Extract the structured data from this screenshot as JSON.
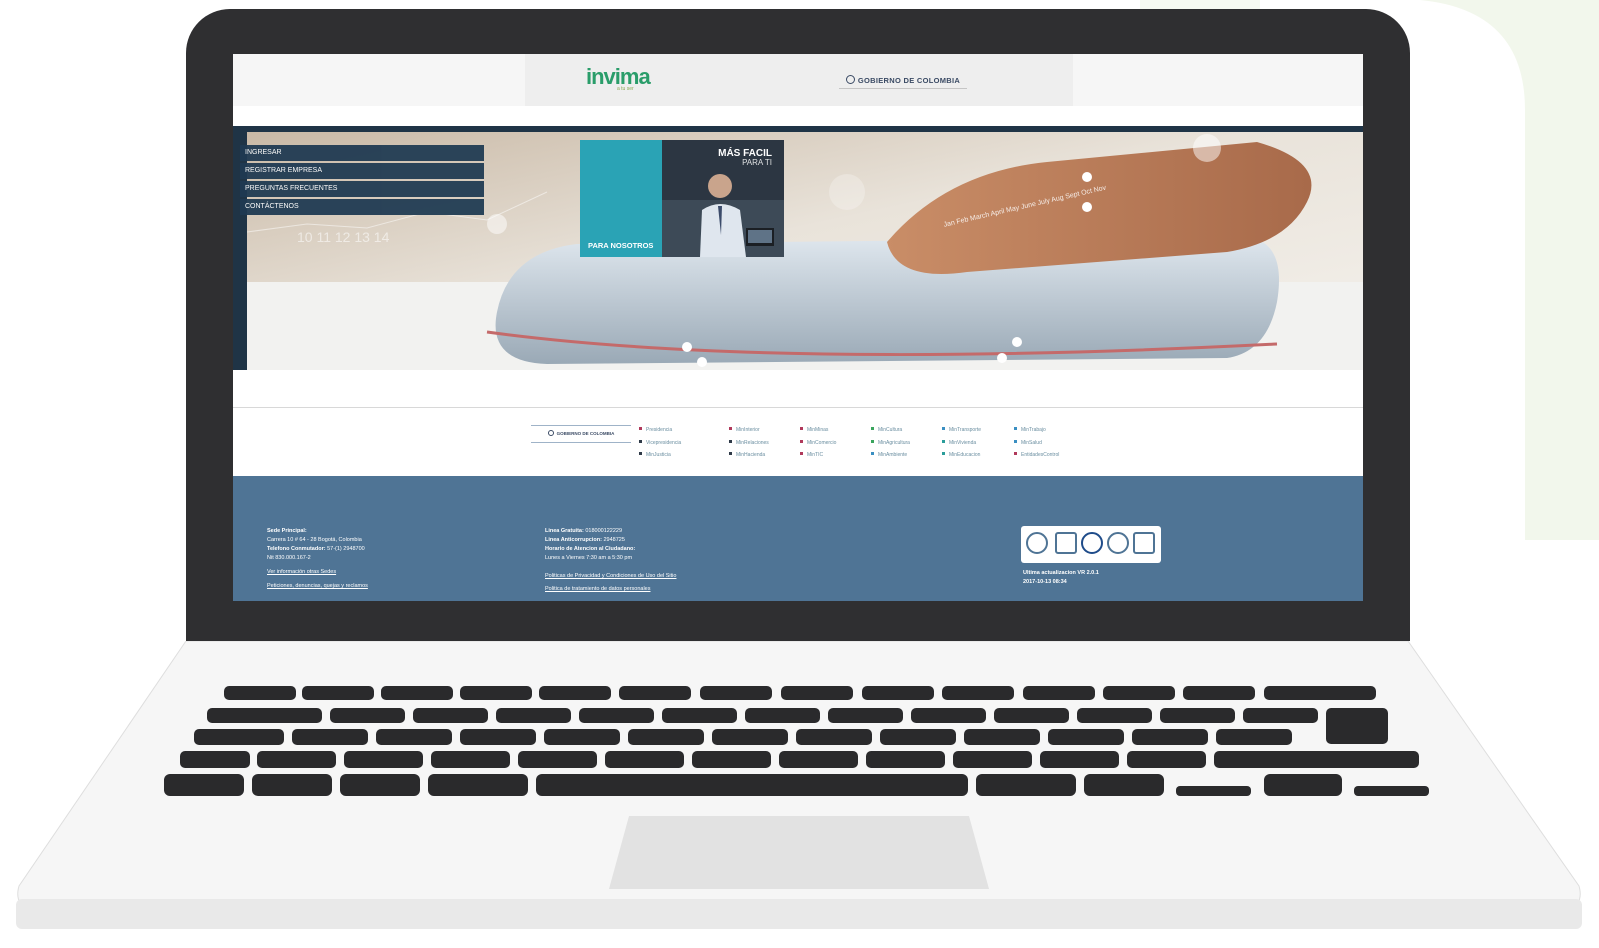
{
  "site": {
    "logo_text": "invima",
    "logo_subtext": "a tu ser",
    "gov_label": "GOBIERNO DE COLOMBIA"
  },
  "menu": {
    "items": [
      {
        "label": "INGRESAR"
      },
      {
        "label": "REGISTRAR EMPRESA"
      },
      {
        "label": "PREGUNTAS FRECUENTES"
      },
      {
        "label": "CONTÁCTENOS"
      }
    ]
  },
  "promo": {
    "title": "MÁS FACIL",
    "subtitle": "PARA TI",
    "caption": "PARA NOSOTROS"
  },
  "hero": {
    "months": "Jan  Feb  March  April  May  June  July  Aug  Sept  Oct  Nov"
  },
  "gov_links": {
    "badge": "GOBIERNO DE COLOMBIA",
    "columns": [
      [
        {
          "label": "Presidencia",
          "color": "#b0395b"
        },
        {
          "label": "Vicepresidencia",
          "color": "#2f3a48"
        },
        {
          "label": "MinJusticia",
          "color": "#2f3a48"
        }
      ],
      [
        {
          "label": "MinInterior",
          "color": "#b0395b"
        },
        {
          "label": "MinRelaciones",
          "color": "#2f3a48"
        },
        {
          "label": "MinHacienda",
          "color": "#2f3a48"
        }
      ],
      [
        {
          "label": "MinMinas",
          "color": "#b0395b"
        },
        {
          "label": "MinComercio",
          "color": "#b0395b"
        },
        {
          "label": "MinTIC",
          "color": "#b0395b"
        }
      ],
      [
        {
          "label": "MinCultura",
          "color": "#3aa55d"
        },
        {
          "label": "MinAgricultura",
          "color": "#3aa55d"
        },
        {
          "label": "MinAmbiente",
          "color": "#3a8fc2"
        }
      ],
      [
        {
          "label": "MinTransporte",
          "color": "#3a8fc2"
        },
        {
          "label": "MinVivienda",
          "color": "#2a9d9a"
        },
        {
          "label": "MinEducacion",
          "color": "#2a9d9a"
        }
      ],
      [
        {
          "label": "MinTrabajo",
          "color": "#3a8fc2"
        },
        {
          "label": "MinSalud",
          "color": "#3a8fc2"
        },
        {
          "label": "EntidadesControl",
          "color": "#b0395b"
        }
      ]
    ]
  },
  "footer": {
    "col1": {
      "sede_label": "Sede Principal:",
      "address": "Carrera 10 # 64 - 28 Bogotá, Colombia",
      "phone_label": "Telefono Conmutador:",
      "phone": " 57-(1) 2948700",
      "nit": "Nit 830.000.167-2",
      "link_sedes": "Ver información otras Sedes",
      "link_pqr": "Peticiones, denuncias, quejas y reclamos"
    },
    "col2": {
      "linea_gratuita_label": "Linea Gratuita:",
      "linea_gratuita": " 018000122229",
      "linea_anticorrupcion_label": "Linea Anticorrupcion:",
      "linea_anticorrupcion": " 2948725",
      "horario_label": "Horario de Atencion al Ciudadano:",
      "horario": "Lunes a Viernes 7:30 am a 5:30 pm",
      "link_privacidad": "Politicas de Privacidad y Condiciones de Uso del Sitio",
      "link_datos": "Politica de tratamiento de datos personales"
    },
    "col3": {
      "update_label": "Ultima actualizacion VR 2.0.1",
      "update_date": "2017-10-13 08:34"
    }
  },
  "colors": {
    "lid": "#2f2f31",
    "footer": "#4f7495",
    "menu": "#1f3a52",
    "accent_teal": "#2aa3b5"
  }
}
